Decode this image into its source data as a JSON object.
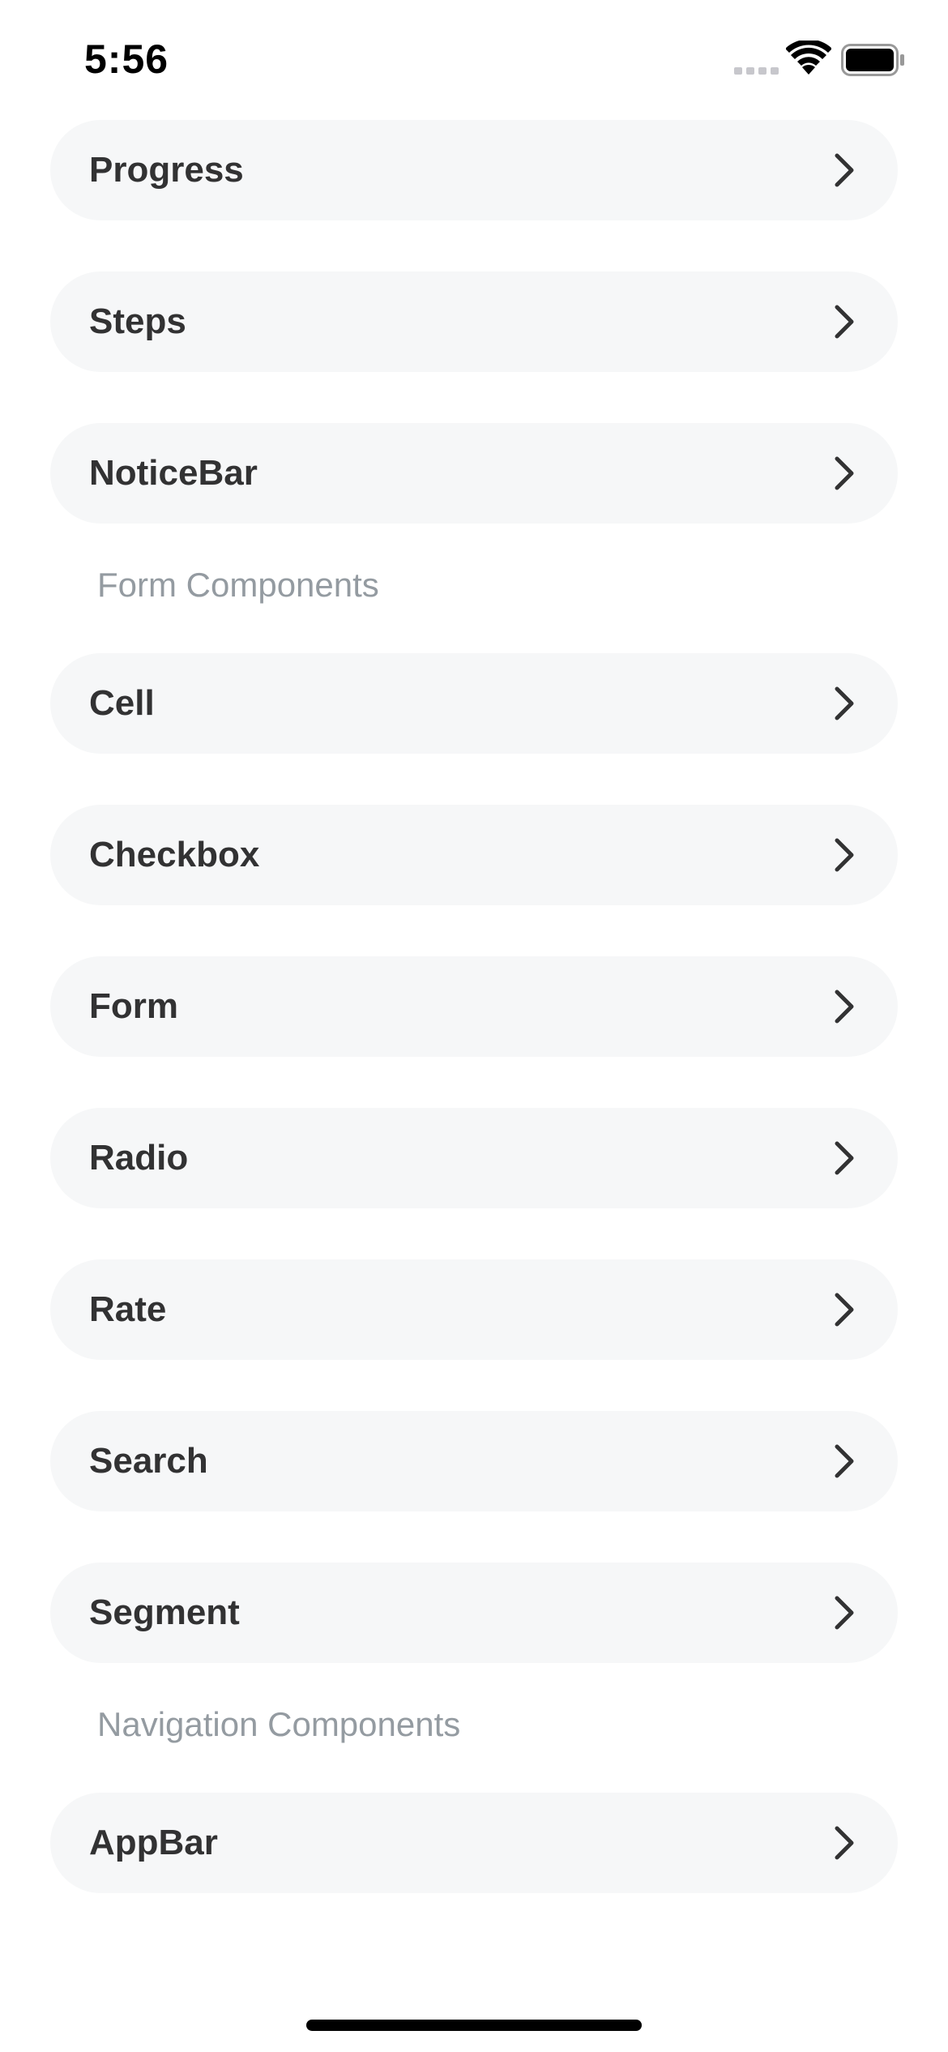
{
  "status_bar": {
    "time": "5:56"
  },
  "sections": [
    {
      "title": "",
      "items": [
        {
          "label": "Progress"
        },
        {
          "label": "Steps"
        },
        {
          "label": "NoticeBar"
        }
      ]
    },
    {
      "title": "Form Components",
      "items": [
        {
          "label": "Cell"
        },
        {
          "label": "Checkbox"
        },
        {
          "label": "Form"
        },
        {
          "label": "Radio"
        },
        {
          "label": "Rate"
        },
        {
          "label": "Search"
        },
        {
          "label": "Segment"
        }
      ]
    },
    {
      "title": "Navigation Components",
      "items": [
        {
          "label": "AppBar"
        }
      ]
    }
  ],
  "icons": {
    "row_trailing": "chevron-right-icon",
    "status": [
      "cellular-signal-icon",
      "wifi-icon",
      "battery-icon"
    ]
  },
  "colors": {
    "row_background": "#f6f7f8",
    "row_text": "#323233",
    "section_title": "#949ba1",
    "page_background": "#ffffff"
  }
}
